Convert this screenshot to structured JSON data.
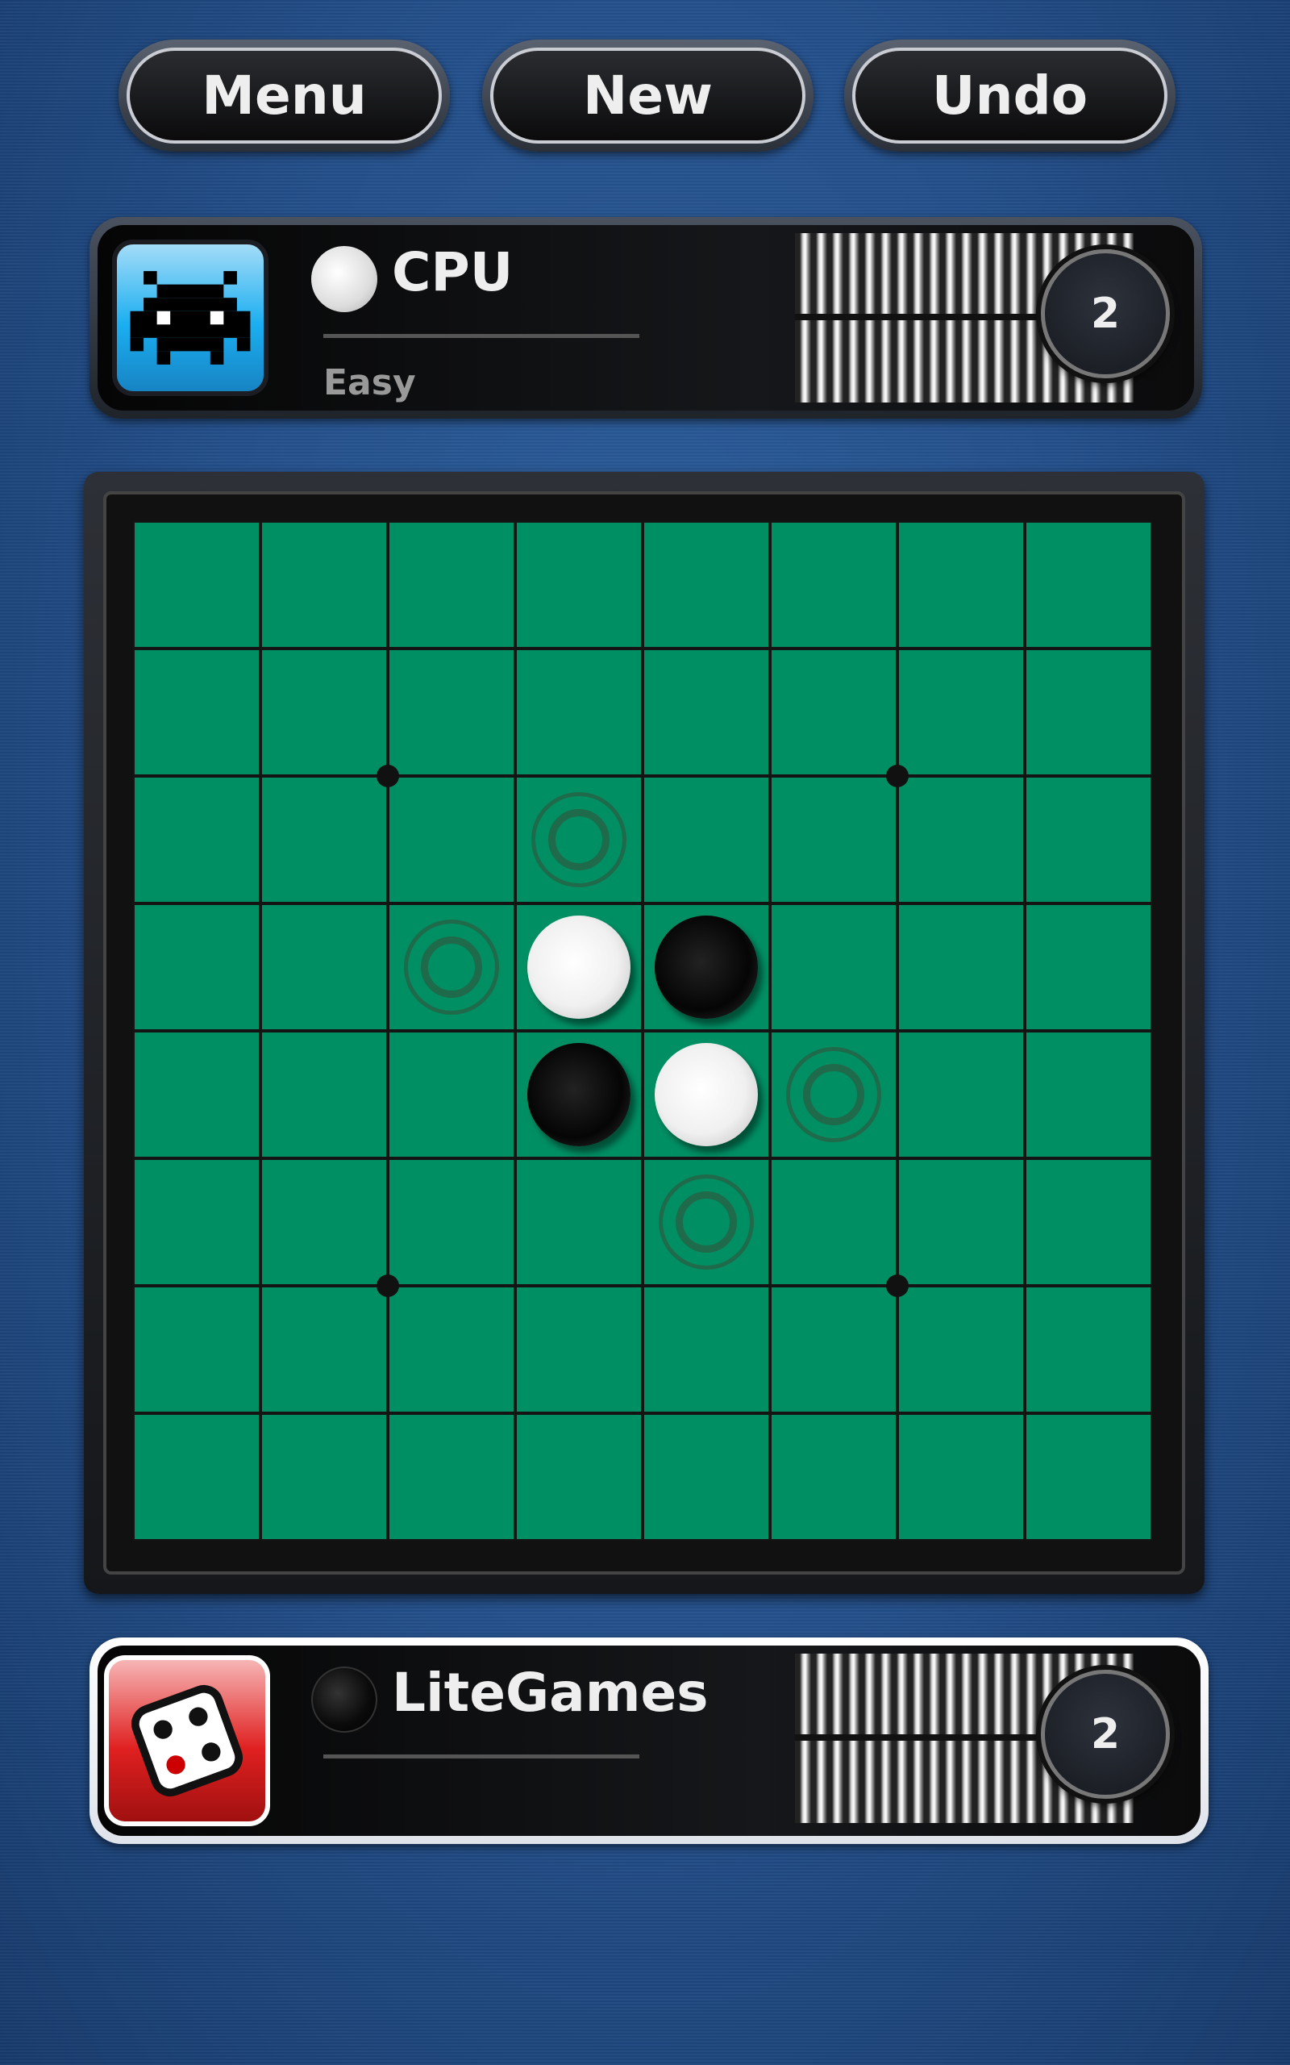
{
  "toolbar": {
    "menu": "Menu",
    "new": "New",
    "undo": "Undo"
  },
  "opponent": {
    "name": "CPU",
    "difficulty": "Easy",
    "disc_color": "white",
    "score": "2",
    "avatar_icon": "space-invader-icon",
    "avatar_color": "#1aaef0"
  },
  "player": {
    "name": "LiteGames",
    "disc_color": "black",
    "score": "2",
    "avatar_icon": "dice-icon",
    "avatar_color": "#e02020",
    "active": true
  },
  "board": {
    "size": 8,
    "color": "#008f63",
    "rows": [
      "........",
      "........",
      "...h....",
      "..hWB...",
      "...BWh..",
      "....h...",
      "........",
      "........"
    ],
    "legend": {
      "W": "white",
      "B": "black",
      "h": "valid-move-hint"
    },
    "star_points": [
      [
        2,
        2
      ],
      [
        2,
        6
      ],
      [
        6,
        2
      ],
      [
        6,
        6
      ]
    ]
  }
}
